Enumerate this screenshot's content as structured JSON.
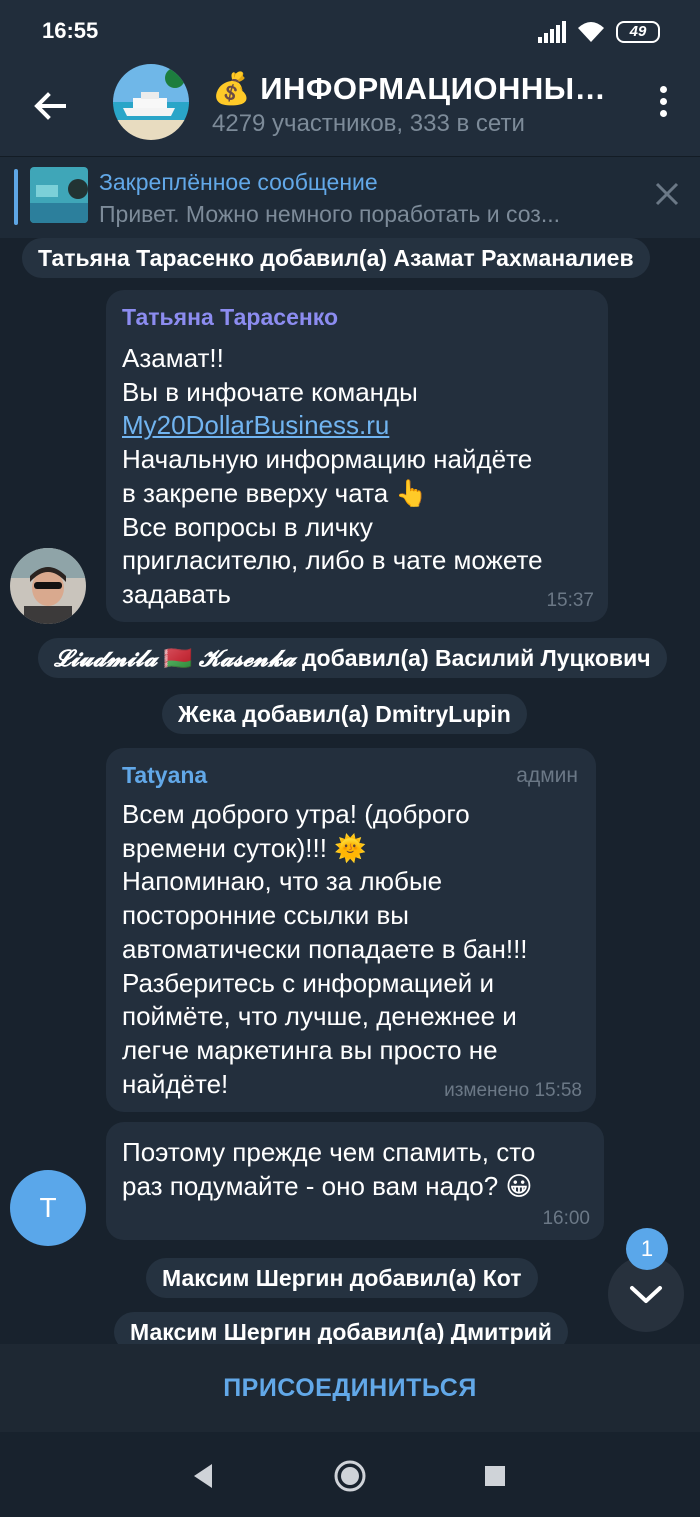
{
  "status_bar": {
    "time": "16:55",
    "battery": "49"
  },
  "header": {
    "title": "💰 ИНФОРМАЦИОННЫЙ...",
    "subtitle": "4279 участников, 333 в сети"
  },
  "pinned": {
    "title": "Закреплённое сообщение",
    "text": "Привет. Можно немного поработать и соз..."
  },
  "messages": {
    "service_1": "Татьяна Тарасенко добавил(а) Азамат Рахманалиев",
    "msg_1": {
      "sender": "Татьяна Тарасенко",
      "sender_color": "#8c8cf0",
      "line_1": "Азамат!!",
      "line_2": "Вы в инфочате команды",
      "link": "My20DollarBusiness.ru",
      "line_3": "Начальную информацию найдёте\nв закрепе вверху чата 👆\nВсе вопросы в личку\nпригласителю, либо в чате можете\nзадавать",
      "time": "15:37"
    },
    "service_2_name_1": "𝓛𝓲𝓾𝓭𝓶𝓲𝓵𝓪",
    "service_2_flag": "🇧🇾",
    "service_2_name_2": "𝓚𝓪𝓼𝓮𝓷𝓴𝓪",
    "service_2_rest": " добавил(а) Василий Луцкович",
    "service_3": "Жека добавил(а) DmitryLupin",
    "msg_2": {
      "sender": "Tatyana",
      "sender_color": "#62a8e8",
      "admin": "админ",
      "text": "Всем доброго утра! (доброго\nвремени суток)!!! 🌞\nНапоминаю, что за любые\nпосторонние ссылки вы\nавтоматически попадаете в бан!!!\nРазберитесь с информацией и\nпоймёте, что лучше, денежнее и\nлегче маркетинга вы просто не\nнайдёте!",
      "time": "изменено 15:58"
    },
    "msg_3": {
      "text": "Поэтому прежде чем спамить, сто\nраз подумайте - оно вам надо? 😀",
      "time": "16:00",
      "avatar_letter": "T"
    },
    "service_4": "Максим Шергин добавил(а) Кот",
    "service_5": "Максим Шергин добавил(а) Дмитрий"
  },
  "scroll_badge": "1",
  "join_button": "ПРИСОЕДИНИТЬСЯ"
}
